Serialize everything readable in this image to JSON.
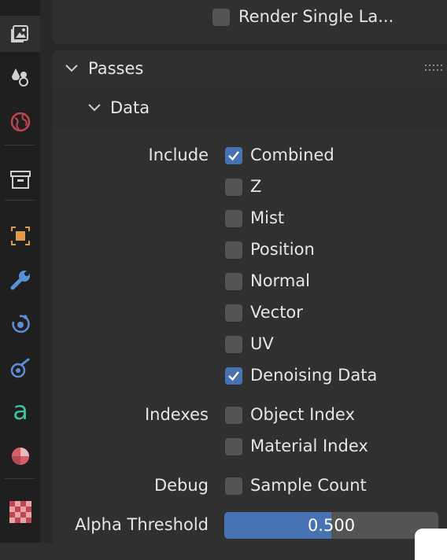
{
  "colors": {
    "accent": "#4772b3",
    "checkbox": "#545454",
    "text": "#e6e6e6",
    "panel": "#303030"
  },
  "sidebar": {
    "tabs": [
      {
        "icon": "output-properties-icon",
        "active": true
      },
      {
        "icon": "view-layer-icon"
      },
      {
        "icon": "scene-properties-icon"
      },
      {
        "icon": "world-properties-icon"
      },
      {
        "icon": "collection-properties-icon"
      },
      {
        "icon": "object-properties-icon"
      },
      {
        "icon": "modifier-wrench-icon"
      },
      {
        "icon": "particles-icon"
      },
      {
        "icon": "physics-icon"
      },
      {
        "icon": "object-data-icon"
      },
      {
        "icon": "material-icon"
      },
      {
        "icon": "texture-checker-icon"
      }
    ]
  },
  "top_option": {
    "label": "Render Single La...",
    "checked": false
  },
  "passes": {
    "title": "Passes",
    "data": {
      "title": "Data",
      "include_label": "Include",
      "include": [
        {
          "label": "Combined",
          "checked": true
        },
        {
          "label": "Z",
          "checked": false
        },
        {
          "label": "Mist",
          "checked": false
        },
        {
          "label": "Position",
          "checked": false
        },
        {
          "label": "Normal",
          "checked": false
        },
        {
          "label": "Vector",
          "checked": false
        },
        {
          "label": "UV",
          "checked": false
        },
        {
          "label": "Denoising Data",
          "checked": true
        }
      ],
      "indexes_label": "Indexes",
      "indexes": [
        {
          "label": "Object Index",
          "checked": false
        },
        {
          "label": "Material Index",
          "checked": false
        }
      ],
      "debug_label": "Debug",
      "debug": [
        {
          "label": "Sample Count",
          "checked": false
        }
      ],
      "alpha_threshold_label": "Alpha Threshold",
      "alpha_threshold": "0.500",
      "alpha_fraction": 0.5
    }
  }
}
